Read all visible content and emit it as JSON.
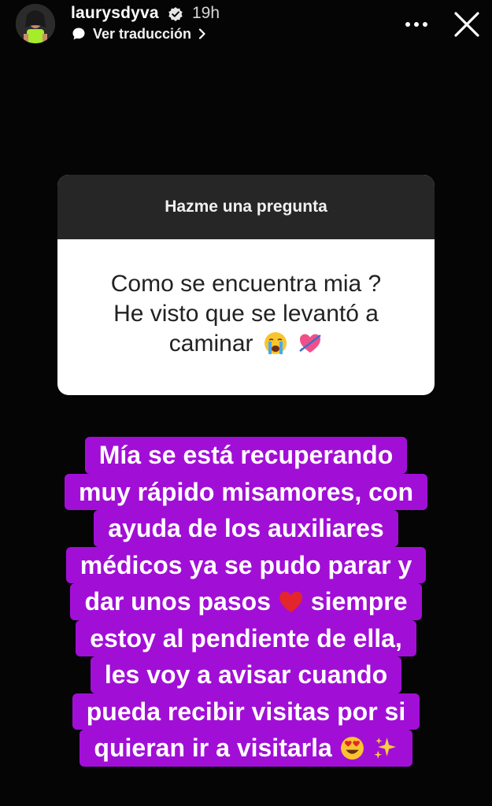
{
  "header": {
    "username": "laurysdyva",
    "time_ago": "19h",
    "translate_label": "Ver traducción",
    "icons": [
      "avatar",
      "verified-badge-icon",
      "translate-bubble-icon",
      "chevron-right-icon",
      "more-icon",
      "close-icon"
    ]
  },
  "question_card": {
    "title": "Hazme una pregunta",
    "lines": [
      "Como se encuentra mia ?",
      "He visto que se levantó a",
      "caminar"
    ],
    "emojis": [
      "crying-face-emoji",
      "heart-with-arrow-emoji"
    ]
  },
  "answer": {
    "highlight_color": "#a10fd6",
    "lines": [
      "Mía se está recuperando",
      "muy rápido misamores, con",
      "ayuda de los auxiliares",
      "médicos ya se pudo parar y",
      "dar unos pasos",
      "siempre",
      "estoy al pendiente de ella,",
      "les voy a avisar cuando",
      "pueda recibir visitas por si",
      "quieran ir a visitarla"
    ],
    "emojis": [
      "red-heart-emoji",
      "heart-eyes-emoji",
      "sparkles-emoji"
    ]
  }
}
